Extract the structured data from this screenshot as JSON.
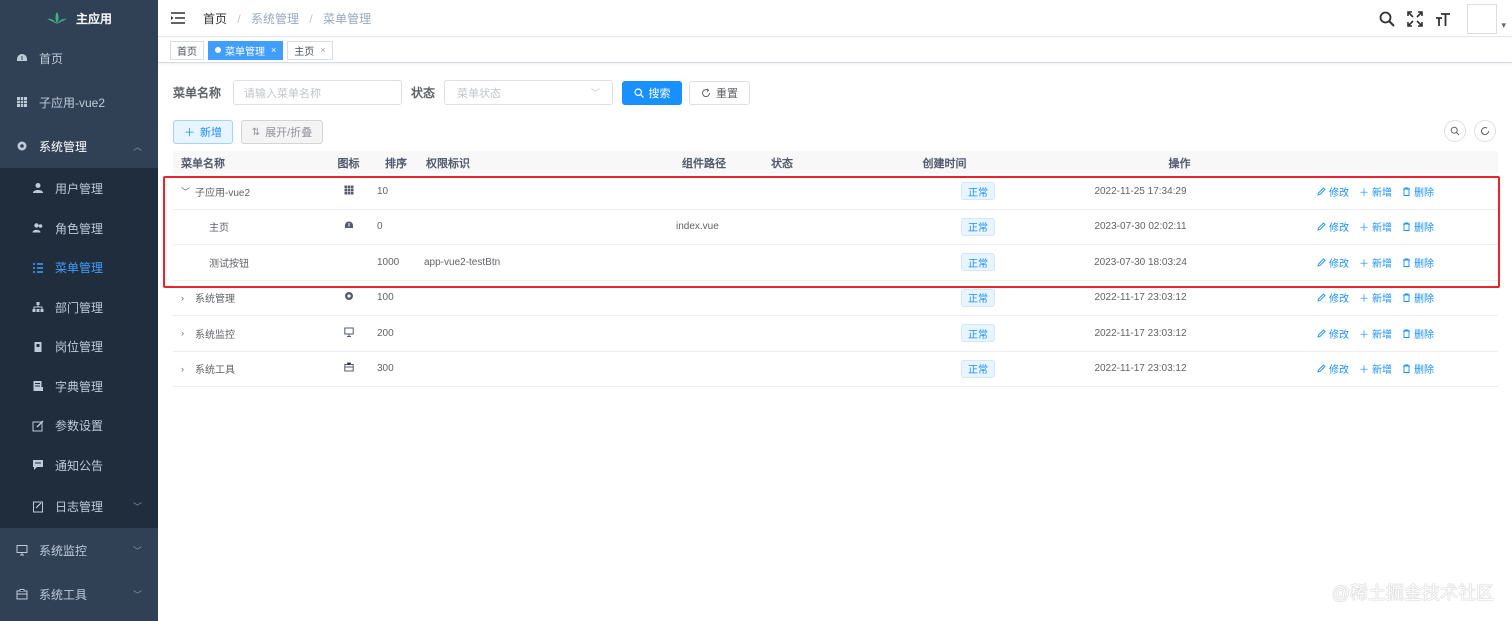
{
  "app": {
    "title": "主应用"
  },
  "sidebar": {
    "items": [
      {
        "label": "首页",
        "icon": "dashboard-icon"
      },
      {
        "label": "子应用-vue2",
        "icon": "grid-icon"
      },
      {
        "label": "系统管理",
        "icon": "gear-icon",
        "expanded": true
      }
    ],
    "subitems": [
      {
        "label": "用户管理",
        "icon": "user-icon"
      },
      {
        "label": "角色管理",
        "icon": "peoples-icon"
      },
      {
        "label": "菜单管理",
        "icon": "tree-table-icon",
        "active": true
      },
      {
        "label": "部门管理",
        "icon": "tree-icon"
      },
      {
        "label": "岗位管理",
        "icon": "post-icon"
      },
      {
        "label": "字典管理",
        "icon": "dict-icon"
      },
      {
        "label": "参数设置",
        "icon": "edit-icon"
      },
      {
        "label": "通知公告",
        "icon": "message-icon"
      },
      {
        "label": "日志管理",
        "icon": "log-icon"
      }
    ],
    "bottom_items": [
      {
        "label": "系统监控",
        "icon": "monitor-icon"
      },
      {
        "label": "系统工具",
        "icon": "tool-icon"
      }
    ]
  },
  "breadcrumb": [
    "首页",
    "系统管理",
    "菜单管理"
  ],
  "tags": [
    {
      "label": "首页",
      "active": false
    },
    {
      "label": "菜单管理",
      "active": true
    },
    {
      "label": "主页",
      "active": false
    }
  ],
  "search": {
    "name_label": "菜单名称",
    "name_placeholder": "请输入菜单名称",
    "status_label": "状态",
    "status_placeholder": "菜单状态",
    "search_btn": "搜索",
    "reset_btn": "重置"
  },
  "toolbar": {
    "add_btn": "新增",
    "expand_btn": "展开/折叠"
  },
  "table": {
    "headers": [
      "菜单名称",
      "图标",
      "排序",
      "权限标识",
      "组件路径",
      "状态",
      "创建时间",
      "操作"
    ],
    "rows": [
      {
        "name": "子应用-vue2",
        "icon": "grid-icon",
        "order": "10",
        "perms": "",
        "component": "",
        "status": "正常",
        "created": "2022-11-25 17:34:29",
        "level": 0,
        "expanded": true
      },
      {
        "name": "主页",
        "icon": "dashboard-icon",
        "order": "0",
        "perms": "",
        "component": "index.vue",
        "status": "正常",
        "created": "2023-07-30 02:02:11",
        "level": 1
      },
      {
        "name": "测试按钮",
        "icon": "",
        "order": "1000",
        "perms": "app-vue2-testBtn",
        "component": "",
        "status": "正常",
        "created": "2023-07-30 18:03:24",
        "level": 1
      },
      {
        "name": "系统管理",
        "icon": "gear-icon",
        "order": "100",
        "perms": "",
        "component": "",
        "status": "正常",
        "created": "2022-11-17 23:03:12",
        "level": 0
      },
      {
        "name": "系统监控",
        "icon": "monitor-icon",
        "order": "200",
        "perms": "",
        "component": "",
        "status": "正常",
        "created": "2022-11-17 23:03:12",
        "level": 0
      },
      {
        "name": "系统工具",
        "icon": "tool-icon",
        "order": "300",
        "perms": "",
        "component": "",
        "status": "正常",
        "created": "2022-11-17 23:03:12",
        "level": 0
      }
    ],
    "ops": {
      "edit": "修改",
      "add": "新增",
      "delete": "删除"
    }
  },
  "watermark": "@稀土掘金技术社区",
  "colors": {
    "sidebar_bg": "#304156",
    "submenu_bg": "#1f2d3d",
    "primary": "#1890ff",
    "highlight_border": "#e8232b"
  }
}
